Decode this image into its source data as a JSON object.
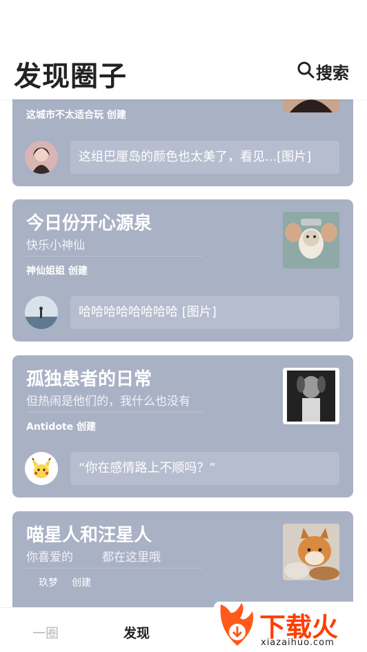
{
  "header": {
    "title": "发现圈子",
    "search_label": "搜索"
  },
  "circles": [
    {
      "title": "",
      "subtitle": "",
      "creator": "这城市不太适合玩 创建",
      "latest_post": "这组巴厘岛的颜色也太美了，看见...[图片]"
    },
    {
      "title": "今日份开心源泉",
      "subtitle": "快乐小神仙",
      "creator": "神仙姐姐 创建",
      "latest_post": "哈哈哈哈哈哈哈哈 [图片]"
    },
    {
      "title": "孤独患者的日常",
      "subtitle": "但热闹是他们的，我什么也没有",
      "creator": "Antidote 创建",
      "latest_post": "“你在感情路上不顺吗？”"
    },
    {
      "title": "喵星人和汪星人",
      "subtitle": "你喜爱的",
      "subtitle_tail": "都在这里哦",
      "creator_name": "玖梦",
      "creator_suffix": "创建"
    }
  ],
  "tabbar": {
    "tab1": "一圈",
    "tab2": "发现"
  },
  "watermark": {
    "text_cn": "下载火",
    "text_en": "xiazaihuo.com"
  },
  "colors": {
    "card_bg": "#a9b1c5",
    "accent": "#ff3d00"
  }
}
